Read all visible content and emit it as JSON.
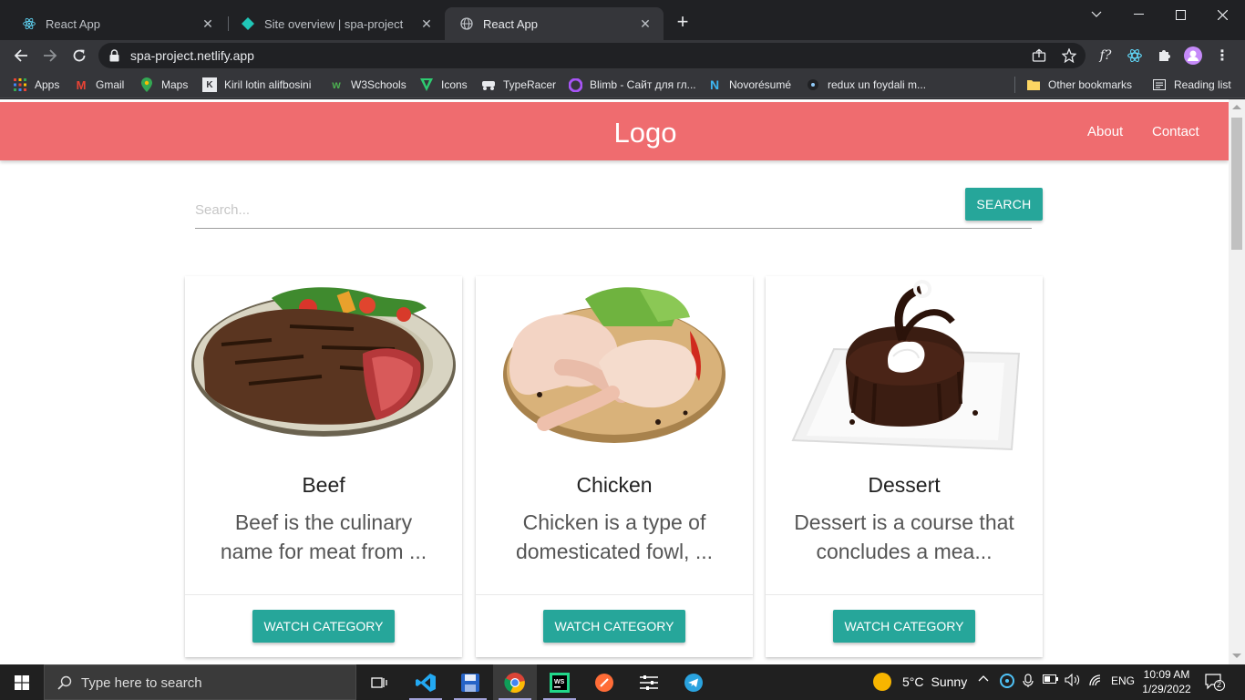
{
  "browser": {
    "tabs": [
      {
        "title": "React App",
        "icon": "react-icon",
        "state": "inactive"
      },
      {
        "title": "Site overview | spa-project",
        "icon": "netlify-icon",
        "state": "inactive"
      },
      {
        "title": "React App",
        "icon": "globe-icon",
        "state": "active"
      }
    ],
    "new_tab_symbol": "+",
    "url": "spa-project.netlify.app",
    "bookmarks": [
      {
        "label": "Apps",
        "icon": "apps-grid-icon"
      },
      {
        "label": "Gmail",
        "icon": "gmail-icon"
      },
      {
        "label": "Maps",
        "icon": "maps-icon"
      },
      {
        "label": "Kiril lotin alifbosini",
        "icon": "kiril-icon"
      },
      {
        "label": "W3Schools",
        "icon": "w3schools-icon"
      },
      {
        "label": "Icons",
        "icon": "icons-icon"
      },
      {
        "label": "TypeRacer",
        "icon": "typeracer-icon"
      },
      {
        "label": "Blimb - Сайт для гл...",
        "icon": "blimb-icon"
      },
      {
        "label": "Novorésumé",
        "icon": "novoresume-icon"
      },
      {
        "label": "redux un foydali m...",
        "icon": "redux-icon"
      }
    ],
    "other_bookmarks": "Other bookmarks",
    "reading_list": "Reading list"
  },
  "site": {
    "logo": "Logo",
    "nav": [
      "About",
      "Contact"
    ],
    "search": {
      "placeholder": "Search...",
      "button": "SEARCH"
    },
    "categories": [
      {
        "title": "Beef",
        "description": "Beef is the culinary name for meat from ...",
        "button": "WATCH CATEGORY",
        "image": "beef-steak-image"
      },
      {
        "title": "Chicken",
        "description": "Chicken is a type of domesticated fowl, ...",
        "button": "WATCH CATEGORY",
        "image": "chicken-legs-image"
      },
      {
        "title": "Dessert",
        "description": "Dessert is a course that concludes a mea...",
        "button": "WATCH CATEGORY",
        "image": "chocolate-cake-image"
      }
    ],
    "accent_color": "#26a69a",
    "header_color": "#ef6c6f"
  },
  "taskbar": {
    "search_placeholder": "Type here to search",
    "weather": {
      "temp": "5°C",
      "condition": "Sunny"
    },
    "language": "ENG",
    "time": "10:09 AM",
    "date": "1/29/2022",
    "notifications": "2"
  }
}
